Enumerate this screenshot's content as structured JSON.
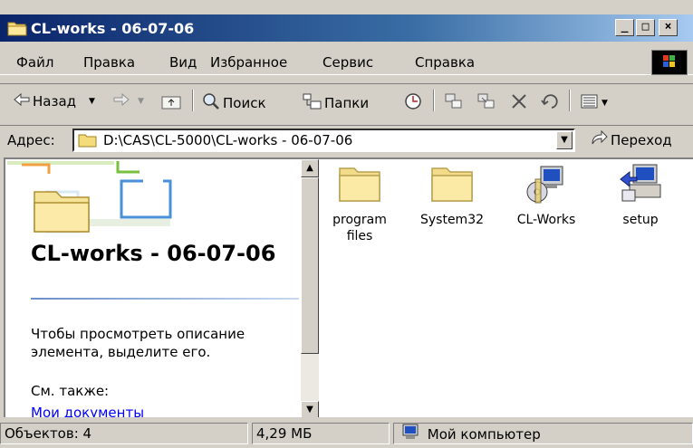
{
  "window": {
    "title": "CL-works - 06-07-06"
  },
  "caption_buttons": {
    "minimize": "_",
    "maximize": "□",
    "close": "×"
  },
  "menu": [
    "Файл",
    "Правка",
    "Вид",
    "Избранное",
    "Сервис",
    "Справка"
  ],
  "toolbar": {
    "back": "Назад",
    "search": "Поиск",
    "folders": "Папки"
  },
  "address": {
    "label": "Адрес:",
    "path": "D:\\CAS\\CL-5000\\CL-works - 06-07-06",
    "go": "Переход"
  },
  "left_panel": {
    "title": "CL-works - 06-07-06",
    "description": "Чтобы просмотреть описание элемента, выделите его.",
    "see_also": "См. также:",
    "link": "Мои документы"
  },
  "items": [
    {
      "label": "program files",
      "icon": "folder-icon"
    },
    {
      "label": "System32",
      "icon": "folder-icon"
    },
    {
      "label": "CL-Works",
      "icon": "application-icon"
    },
    {
      "label": "setup",
      "icon": "setup-icon"
    }
  ],
  "status": {
    "objects": "Объектов: 4",
    "size": "4,29 МБ",
    "zone": "Мой компьютер"
  }
}
